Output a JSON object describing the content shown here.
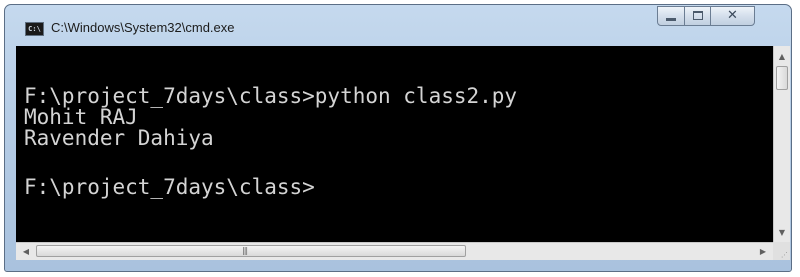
{
  "window": {
    "title": "C:\\Windows\\System32\\cmd.exe",
    "app_icon_text": "C:\\",
    "caption_buttons": {
      "close_symbol": "✕"
    }
  },
  "console": {
    "lines": [
      "F:\\project_7days\\class>python class2.py",
      "Mohit RAJ",
      "Ravender Dahiya",
      "F:\\project_7days\\class>"
    ]
  },
  "scrollbars": {
    "up_arrow": "▲",
    "down_arrow": "▼",
    "left_arrow": "◀",
    "right_arrow": "▶",
    "grip": "|||"
  }
}
